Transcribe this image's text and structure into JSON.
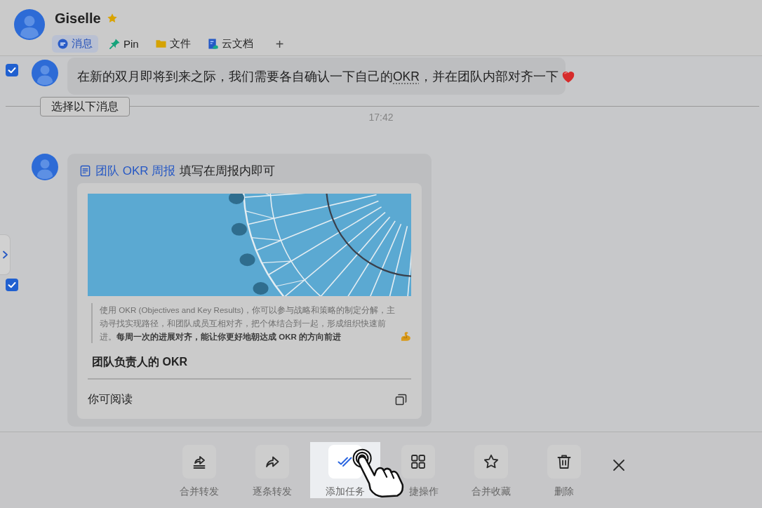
{
  "header": {
    "name": "Giselle",
    "starred": true,
    "tabs": [
      {
        "kind": "messages",
        "label": "消息",
        "selected": true
      },
      {
        "kind": "pin",
        "label": "Pin",
        "selected": false
      },
      {
        "kind": "files",
        "label": "文件",
        "selected": false
      },
      {
        "kind": "docs",
        "label": "云文档",
        "selected": false
      }
    ],
    "add_tab": "+"
  },
  "timeline": [
    {
      "kind": "text",
      "checked": true,
      "parts": [
        {
          "text": "在新的双月即将到来之际，我们需要各自确认一下自己的",
          "underlined": false
        },
        {
          "text": "OKR",
          "underlined": true
        },
        {
          "text": "，并在团队内部对齐一下",
          "underlined": false
        }
      ]
    },
    {
      "kind": "separator",
      "button": "选择以下消息",
      "time": "17:42"
    },
    {
      "kind": "doc",
      "checked": true,
      "link": "团队 OKR 周报",
      "caption": "填写在周报内即可",
      "card": {
        "quote": "使用 OKR (Objectives and Key Results)，你可以参与战略和策略的制定分解，主动寻找实现路径，和团队成员互相对齐，把个体结合到一起，形成组织快速前进。**每周一次的进展对齐，能让你更好地朝达成 OKR 的方向前进**",
        "heading": "团队负责人的 OKR",
        "permission": "你可阅读"
      }
    }
  ],
  "toolbar": {
    "actions": [
      {
        "kind": "merge-forward",
        "label": "合并转发",
        "selected": false
      },
      {
        "kind": "forward-each",
        "label": "逐条转发",
        "selected": false
      },
      {
        "kind": "add-task",
        "label": "添加任务",
        "selected": true
      },
      {
        "kind": "quick-actions",
        "label": "捷操作",
        "selected": false
      },
      {
        "kind": "merge-favorite",
        "label": "合并收藏",
        "selected": false
      },
      {
        "kind": "delete",
        "label": "删除",
        "selected": false
      }
    ]
  }
}
